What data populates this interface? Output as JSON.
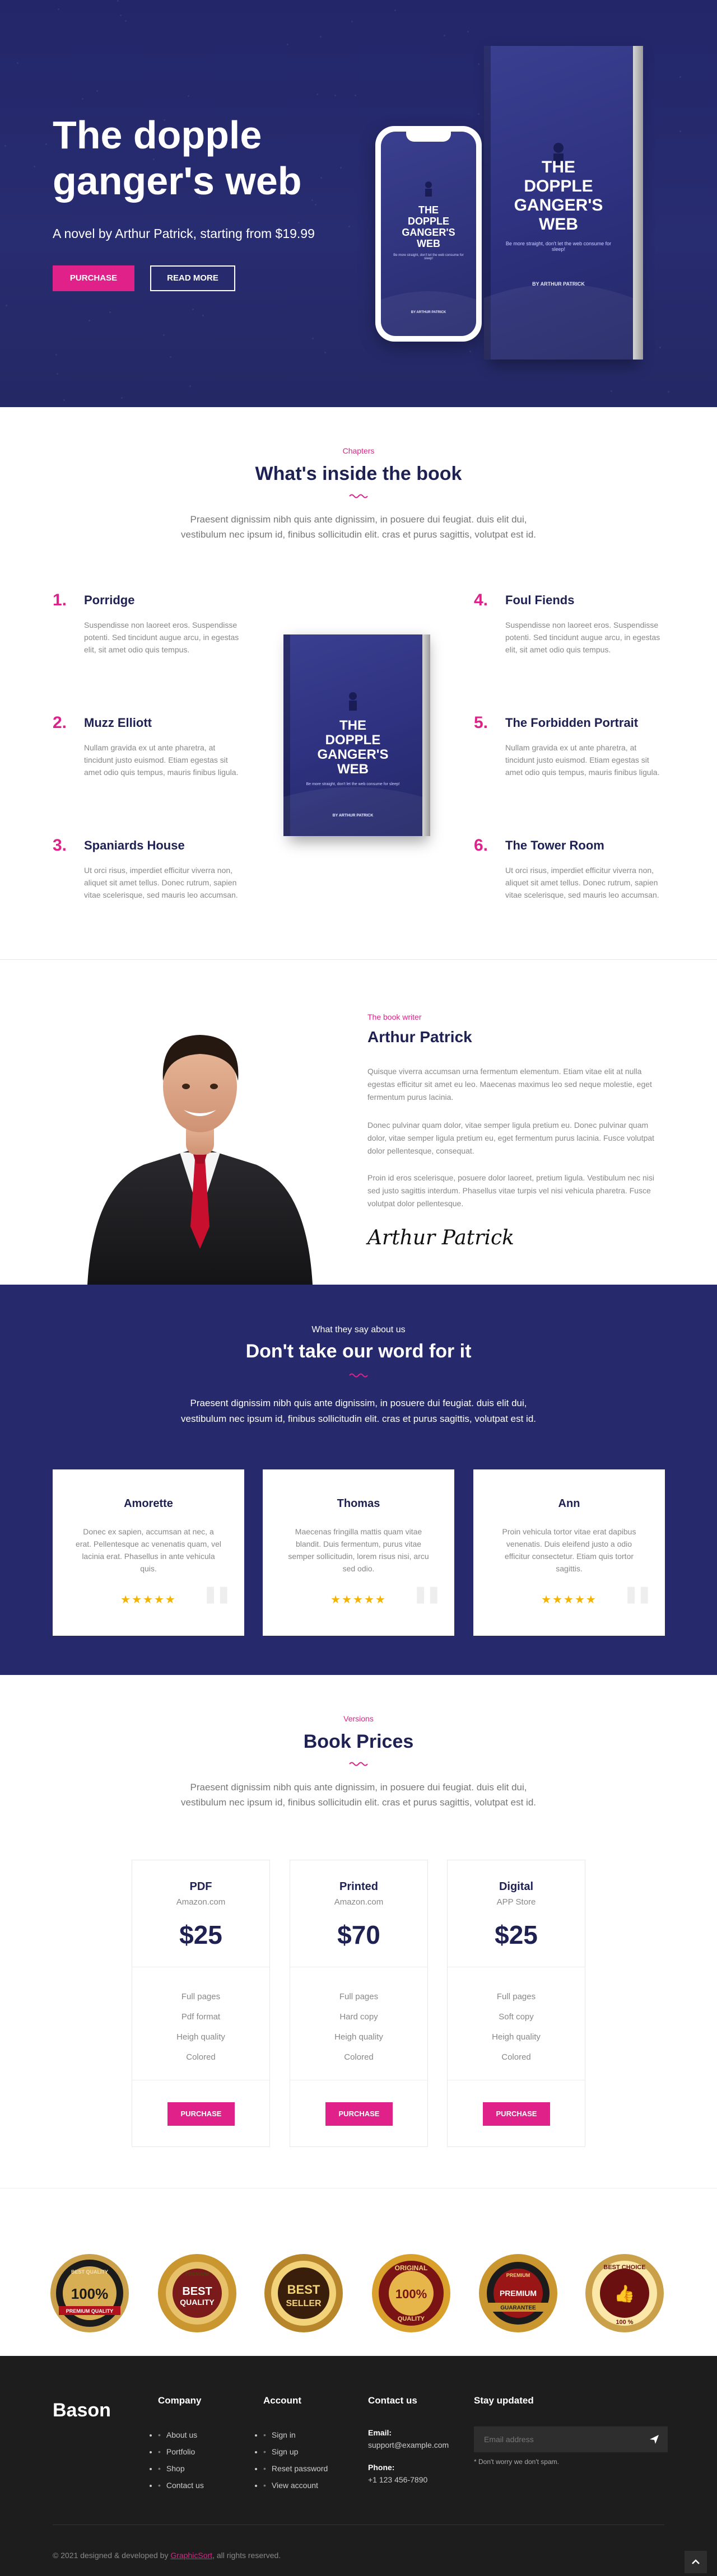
{
  "hero": {
    "title": "The dopple ganger's web",
    "subtitle": "A novel by Arthur Patrick, starting from $19.99",
    "purchase_label": "PURCHASE",
    "read_more_label": "READ MORE"
  },
  "book_cover": {
    "title_lines": [
      "THE",
      "DOPPLE",
      "GANGER'S",
      "WEB"
    ],
    "tagline": "Be more straight, don't let the web consume for sleep!",
    "author": "BY ARTHUR PATRICK"
  },
  "chapters": {
    "kicker": "Chapters",
    "title": "What's inside the book",
    "para_line1": "Praesent dignissim nibh quis ante dignissim, in posuere dui feugiat. duis elit dui,",
    "para_line2": "vestibulum nec ipsum id, finibus sollicitudin elit. cras et purus sagittis, volutpat est id.",
    "items": [
      {
        "num": "1.",
        "title": "Porridge",
        "desc": "Suspendisse non laoreet eros. Suspendisse potenti. Sed tincidunt augue arcu, in egestas elit, sit amet odio quis tempus."
      },
      {
        "num": "2.",
        "title": "Muzz Elliott",
        "desc": "Nullam gravida ex ut ante pharetra, at tincidunt justo euismod. Etiam egestas sit amet odio quis tempus, mauris finibus ligula."
      },
      {
        "num": "3.",
        "title": "Spaniards House",
        "desc": "Ut orci risus, imperdiet efficitur viverra non, aliquet sit amet tellus. Donec rutrum, sapien vitae scelerisque, sed mauris leo accumsan."
      },
      {
        "num": "4.",
        "title": "Foul Fiends",
        "desc": "Suspendisse non laoreet eros. Suspendisse potenti. Sed tincidunt augue arcu, in egestas elit, sit amet odio quis tempus."
      },
      {
        "num": "5.",
        "title": "The Forbidden Portrait",
        "desc": "Nullam gravida ex ut ante pharetra, at tincidunt justo euismod. Etiam egestas sit amet odio quis tempus, mauris finibus ligula."
      },
      {
        "num": "6.",
        "title": "The Tower Room",
        "desc": "Ut orci risus, imperdiet efficitur viverra non, aliquet sit amet tellus. Donec rutrum, sapien vitae scelerisque, sed mauris leo accumsan."
      }
    ]
  },
  "author": {
    "kicker": "The book writer",
    "name": "Arthur Patrick",
    "p1": "Quisque viverra accumsan urna fermentum elementum. Etiam vitae elit at nulla egestas efficitur sit amet eu leo. Maecenas maximus leo sed neque molestie, eget fermentum purus lacinia.",
    "p2": "Donec pulvinar quam dolor, vitae semper ligula pretium eu. Donec pulvinar quam dolor, vitae semper ligula pretium eu, eget fermentum purus lacinia. Fusce volutpat dolor pellentesque, consequat.",
    "p3": "Proin id eros scelerisque, posuere dolor laoreet, pretium ligula. Vestibulum nec nisi sed justo sagittis interdum. Phasellus vitae turpis vel nisi vehicula pharetra. Fusce volutpat dolor pellentesque.",
    "signature": "Arthur Patrick"
  },
  "testimonials": {
    "kicker": "What they say about us",
    "title": "Don't take our word for it",
    "para_line1": "Praesent dignissim nibh quis ante dignissim, in posuere dui feugiat. duis elit dui,",
    "para_line2": "vestibulum nec ipsum id, finibus sollicitudin elit. cras et purus sagittis, volutpat est id.",
    "items": [
      {
        "name": "Amorette",
        "text": "Donec ex sapien, accumsan at nec, a erat. Pellentesque ac venenatis quam, vel lacinia erat. Phasellus in ante vehicula quis.",
        "stars": "★★★★★"
      },
      {
        "name": "Thomas",
        "text": "Maecenas fringilla mattis quam vitae blandit. Duis fermentum, purus vitae semper sollicitudin, lorem risus nisi, arcu sed odio.",
        "stars": "★★★★★"
      },
      {
        "name": "Ann",
        "text": "Proin vehicula tortor vitae erat dapibus venenatis. Duis eleifend justo a odio efficitur consectetur. Etiam quis tortor sagittis.",
        "stars": "★★★★★"
      }
    ]
  },
  "prices": {
    "kicker": "Versions",
    "title": "Book Prices",
    "para_line1": "Praesent dignissim nibh quis ante dignissim, in posuere dui feugiat. duis elit dui,",
    "para_line2": "vestibulum nec ipsum id, finibus sollicitudin elit. cras et purus sagittis, volutpat est id.",
    "plans": [
      {
        "name": "PDF",
        "store": "Amazon.com",
        "price": "$25",
        "features": [
          "Full pages",
          "Pdf format",
          "Heigh quality",
          "Colored"
        ],
        "button": "PURCHASE"
      },
      {
        "name": "Printed",
        "store": "Amazon.com",
        "price": "$70",
        "features": [
          "Full pages",
          "Hard copy",
          "Heigh quality",
          "Colored"
        ],
        "button": "PURCHASE"
      },
      {
        "name": "Digital",
        "store": "APP Store",
        "price": "$25",
        "features": [
          "Full pages",
          "Soft copy",
          "Heigh quality",
          "Colored"
        ],
        "button": "PURCHASE"
      }
    ]
  },
  "badges": [
    {
      "top": "BEST QUALITY",
      "main": "100%",
      "sub": "PREMIUM QUALITY"
    },
    {
      "top": "PREMIUM",
      "main": "BEST",
      "sub": "QUALITY"
    },
    {
      "top": "",
      "main": "BEST",
      "sub": "SELLER"
    },
    {
      "top": "ORIGINAL",
      "main": "100%",
      "sub": "QUALITY"
    },
    {
      "top": "PREMIUM",
      "main": "PREMIUM",
      "sub": "GUARANTEE"
    },
    {
      "top": "BEST CHOICE",
      "main": "👍",
      "sub": "100 %"
    }
  ],
  "footer": {
    "logo": "Bason",
    "company_heading": "Company",
    "company_links": [
      "About us",
      "Portfolio",
      "Shop",
      "Contact us"
    ],
    "account_heading": "Account",
    "account_links": [
      "Sign in",
      "Sign up",
      "Reset password",
      "View account"
    ],
    "contact_heading": "Contact us",
    "email_label": "Email:",
    "email_value": "support@example.com",
    "phone_label": "Phone:",
    "phone_value": "+1 123 456-7890",
    "updates_heading": "Stay updated",
    "email_placeholder": "Email address",
    "note": "* Don't worry we don't spam.",
    "copyright_prefix": "© 2021 designed & developed by",
    "copyright_link": "GraphicSort",
    "copyright_suffix": ", all rights reserved."
  },
  "colors": {
    "accent": "#e0218a",
    "navy": "#26296a",
    "footer": "#1d1d1d",
    "star": "#f5b301"
  }
}
